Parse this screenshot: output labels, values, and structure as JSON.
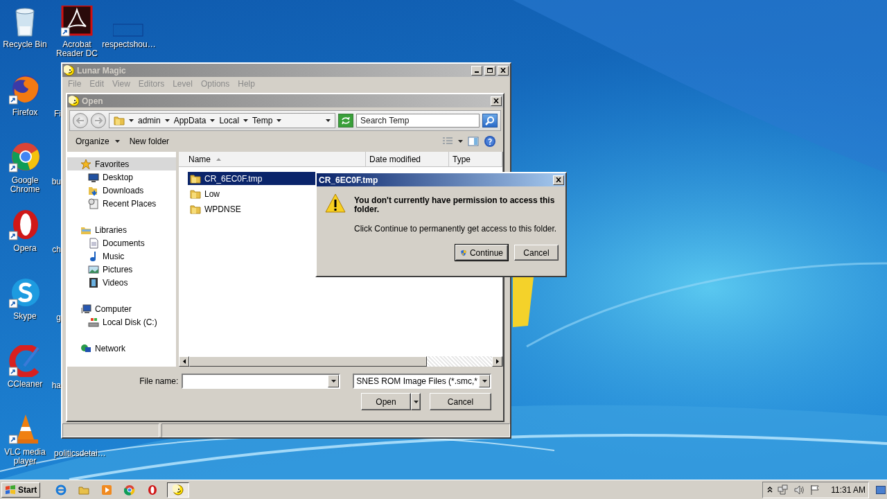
{
  "desktop": {
    "icons": [
      {
        "label": "Recycle Bin"
      },
      {
        "label": "Acrobat Reader DC"
      },
      {
        "label": "respectshou…"
      },
      {
        "label": "Firefox"
      },
      {
        "label": "Google Chrome"
      },
      {
        "label": "Opera"
      },
      {
        "label": "Skype"
      },
      {
        "label": "CCleaner"
      },
      {
        "label": "VLC media player"
      }
    ],
    "partly_hidden_labels": [
      "Fi",
      "bu",
      "ch",
      "g",
      "ha",
      "politicsdetai…"
    ]
  },
  "window": {
    "title": "Lunar Magic",
    "menu": [
      {
        "label": "File",
        "disabled": true
      },
      {
        "label": "Edit",
        "disabled": true
      },
      {
        "label": "View",
        "disabled": true
      },
      {
        "label": "Editors",
        "disabled": true
      },
      {
        "label": "Level",
        "disabled": true
      },
      {
        "label": "Options",
        "disabled": true
      },
      {
        "label": "Help",
        "disabled": true
      }
    ]
  },
  "open_dialog": {
    "title": "Open",
    "breadcrumb": [
      "admin",
      "AppData",
      "Local",
      "Temp"
    ],
    "search": {
      "placeholder": "Search Temp"
    },
    "toolbar": [
      "Organize",
      "New folder"
    ],
    "navigation": [
      {
        "label": "Favorites",
        "selected": true,
        "children": [
          {
            "label": "Desktop",
            "selected": false
          },
          {
            "label": "Downloads",
            "selected": false
          },
          {
            "label": "Recent Places",
            "selected": false
          }
        ]
      },
      {
        "label": "Libraries",
        "selected": false,
        "children": [
          {
            "label": "Documents",
            "selected": false
          },
          {
            "label": "Music",
            "selected": false
          },
          {
            "label": "Pictures",
            "selected": false
          },
          {
            "label": "Videos",
            "selected": false
          }
        ]
      },
      {
        "label": "Computer",
        "selected": false,
        "children": [
          {
            "label": "Local Disk (C:)",
            "selected": false
          }
        ]
      },
      {
        "label": "Network",
        "selected": false
      }
    ],
    "columns": [
      "Name",
      "Date modified",
      "Type"
    ],
    "files": [
      {
        "name": "CR_6EC0F.tmp",
        "selected": true
      },
      {
        "name": "Low",
        "selected": false
      },
      {
        "name": "WPDNSE",
        "selected": false
      }
    ],
    "file_name": {
      "label": "File name:"
    },
    "file_type": {
      "value": "SNES ROM Image Files (*.smc,*"
    },
    "buttons": [
      "Open",
      "Cancel"
    ]
  },
  "permission_dialog": {
    "title": "CR_6EC0F.tmp",
    "message": "You don't currently have permission to access this folder.",
    "detail": "Click Continue to permanently get access to this folder.",
    "buttons": [
      "Continue",
      "Cancel"
    ]
  },
  "taskbar": {
    "start": "Start",
    "apps": [
      {
        "selected": false
      },
      {
        "selected": false
      },
      {
        "selected": false
      },
      {
        "selected": false
      },
      {
        "selected": false
      },
      {
        "selected": true
      }
    ],
    "clock": "11:31 AM"
  }
}
